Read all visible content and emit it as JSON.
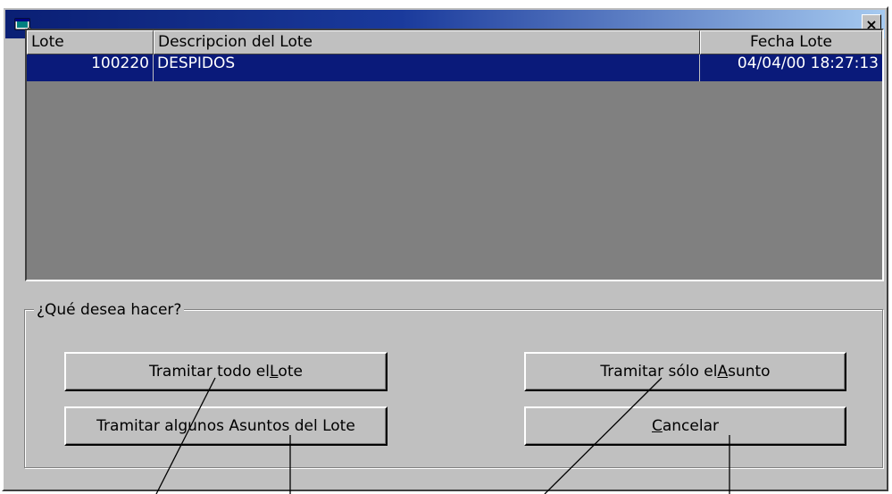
{
  "window": {
    "close_label": "×"
  },
  "list": {
    "columns": [
      "Lote",
      "Descripcion del Lote",
      "Fecha Lote"
    ],
    "rows": [
      {
        "lote": "100220",
        "descripcion": "DESPIDOS",
        "fecha": "04/04/00 18:27:13"
      }
    ]
  },
  "options": {
    "legend": "¿Qué desea hacer?",
    "buttons": {
      "todo_lote": {
        "before": "Tramitar todo el ",
        "accel": "L",
        "after": "ote"
      },
      "algunos": {
        "before": "Tramitar algunos Asuntos del Lote",
        "accel": "",
        "after": ""
      },
      "solo_asunto": {
        "before": "Tramitar sólo el ",
        "accel": "A",
        "after": "sunto"
      },
      "cancelar": {
        "before": "",
        "accel": "C",
        "after": "ancelar"
      }
    }
  },
  "colors": {
    "title_gradient_start": "#0a1f74",
    "selection": "#0a1a7a",
    "face": "#c0c0c0",
    "list_background": "#808080"
  }
}
